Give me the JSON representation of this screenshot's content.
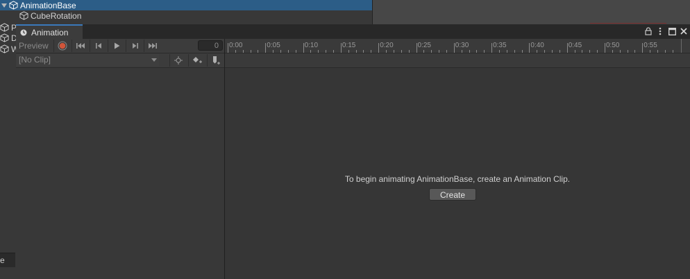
{
  "hierarchy": {
    "items": [
      {
        "label": "AnimationBase",
        "selected": true,
        "icon": "cube-icon"
      },
      {
        "label": "CubeRotation",
        "selected": false,
        "icon": "cube-icon"
      }
    ],
    "edge_items": [
      "P",
      "D",
      "W"
    ],
    "edge_panel_label": "e"
  },
  "animation_window": {
    "tab_title": "Animation",
    "toolbar": {
      "preview_label": "Preview",
      "frame_value": "0"
    },
    "clip_selector": {
      "selected": "[No Clip]"
    },
    "ruler_labels": [
      "0:00",
      "0:05",
      "0:10",
      "0:15",
      "0:20",
      "0:25",
      "0:30",
      "0:35",
      "0:40",
      "0:45",
      "0:50",
      "0:55"
    ],
    "empty_message": "To begin animating AnimationBase, create an Animation Clip.",
    "create_label": "Create"
  },
  "colors": {
    "selection": "#2c5d87",
    "tab_accent": "#3a79bb",
    "record": "#d0553a"
  }
}
